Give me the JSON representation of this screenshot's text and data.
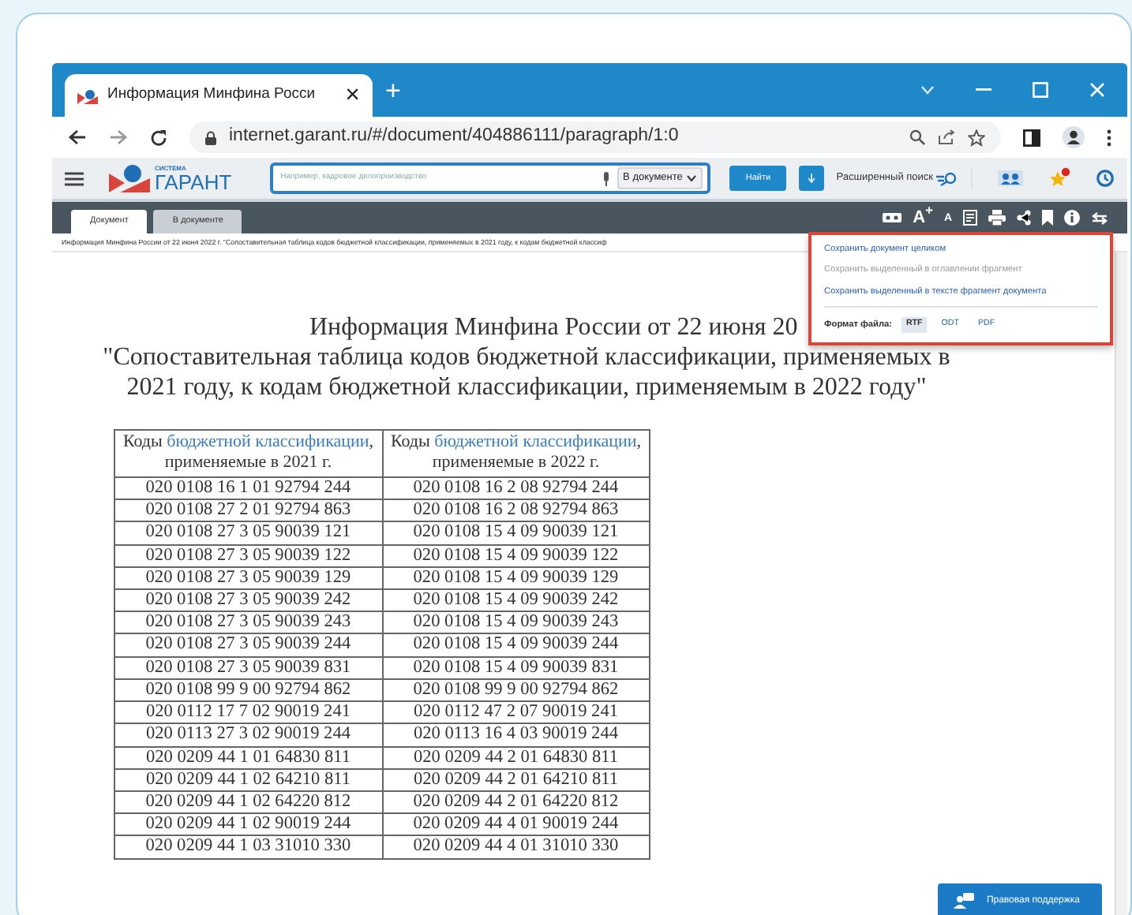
{
  "browser": {
    "tab": {
      "title": "Информация Минфина Росси",
      "close": "×"
    },
    "new_tab": "+",
    "url": "internet.garant.ru/#/document/404886111/paragraph/1:0"
  },
  "toolbar": {
    "logo_caption": "СИСТЕМА",
    "logo": "ГАРАНТ",
    "search_placeholder": "Например, кадровое делопроизводство",
    "scope": "В документе",
    "find": "Найти",
    "advanced": "Расширенный поиск"
  },
  "doc_tabs": [
    {
      "label": "Документ",
      "selected": true
    },
    {
      "label": "В документе",
      "selected": false
    }
  ],
  "doc_tools": {
    "font_larger": "A$^{+}$",
    "font_smaller": "A"
  },
  "breadcrumb": "Информация Минфина России от 22 июня 2022 г. \"Сопоставительная таблица кодов бюджетной классификации, применяемых в 2021 году, к кодам бюджетной классиф",
  "save_menu": {
    "items": [
      {
        "label": "Сохранить документ целиком",
        "disabled": false
      },
      {
        "label": "Сохранить выделенный в оглавлении фрагмент",
        "disabled": true
      },
      {
        "label": "Сохранить выделенный в тексте фрагмент документа",
        "disabled": false
      }
    ],
    "format_label": "Формат файла:",
    "formats": [
      {
        "label": "RTF",
        "selected": true
      },
      {
        "label": "ODT",
        "selected": false
      },
      {
        "label": "PDF",
        "selected": false
      }
    ]
  },
  "document": {
    "title": "Информация Минфина России от 22 июня 20",
    "subtitle": "\"Сопоставительная таблица кодов бюджетной классификации, применяемых в 2021 году, к кодам бюджетной классификации, применяемым в 2022 году\"",
    "table": {
      "columns": [
        {
          "before": "Коды ",
          "link": "бюджетной классификации",
          "after": ", применяемые в 2021 г."
        },
        {
          "before": "Коды ",
          "link": "бюджетной классификации",
          "after": ", применяемые в 2022 г."
        }
      ],
      "rows": [
        [
          "020 0108 16 1 01 92794 244",
          "020 0108 16 2 08 92794 244"
        ],
        [
          "020 0108 27 2 01 92794 863",
          "020 0108 16 2 08 92794 863"
        ],
        [
          "020 0108 27 3 05 90039 121",
          "020 0108 15 4 09 90039 121"
        ],
        [
          "020 0108 27 3 05 90039 122",
          "020 0108 15 4 09 90039 122"
        ],
        [
          "020 0108 27 3 05 90039 129",
          "020 0108 15 4 09 90039 129"
        ],
        [
          "020 0108 27 3 05 90039 242",
          "020 0108 15 4 09 90039 242"
        ],
        [
          "020 0108 27 3 05 90039 243",
          "020 0108 15 4 09 90039 243"
        ],
        [
          "020 0108 27 3 05 90039 244",
          "020 0108 15 4 09 90039 244"
        ],
        [
          "020 0108 27 3 05 90039 831",
          "020 0108 15 4 09 90039 831"
        ],
        [
          "020 0108 99 9 00 92794 862",
          "020 0108 99 9 00 92794 862"
        ],
        [
          "020 0112 17 7 02 90019 241",
          "020 0112 47 2 07 90019 241"
        ],
        [
          "020 0113 27 3 02 90019 244",
          "020 0113 16 4 03 90019 244"
        ],
        [
          "020 0209 44 1 01 64830 811",
          "020 0209 44 2 01 64830 811"
        ],
        [
          "020 0209 44 1 02 64210 811",
          "020 0209 44 2 01 64210 811"
        ],
        [
          "020 0209 44 1 02 64220 812",
          "020 0209 44 2 01 64220 812"
        ],
        [
          "020 0209 44 1 02 90019 244",
          "020 0209 44 4 01 90019 244"
        ],
        [
          "020 0209 44 1 03 31010 330",
          "020 0209 44 4 01 31010 330"
        ]
      ]
    }
  },
  "support_button": "Правовая поддержка"
}
